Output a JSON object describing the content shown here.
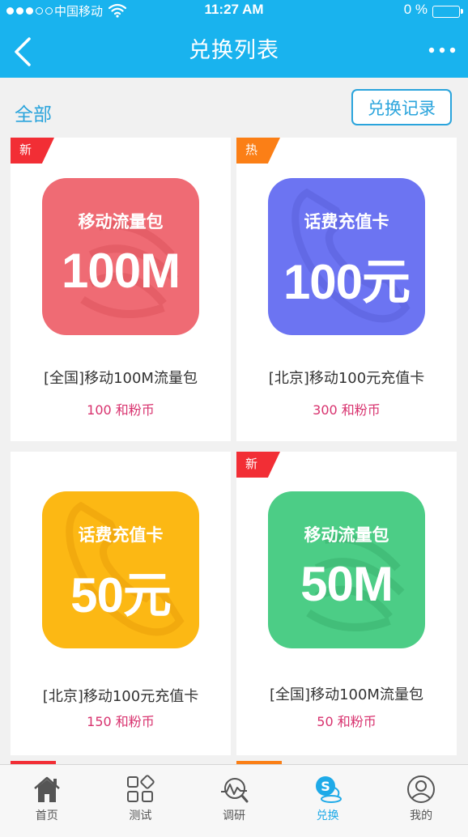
{
  "status_bar": {
    "carrier": "中国移动",
    "time": "11:27 AM",
    "battery": "0 %"
  },
  "nav": {
    "title": "兑换列表"
  },
  "filter": {
    "all_label": "全部",
    "history_label": "兑换记录"
  },
  "items": [
    {
      "badge": "新",
      "badge_color": "#f22e35",
      "tile_color": "#ef6b74",
      "tile_subtitle": "移动流量包",
      "tile_value": "100M",
      "watermark": "china-mobile-logo",
      "name": "[全国]移动100M流量包",
      "price": "100 和粉币"
    },
    {
      "badge": "热",
      "badge_color": "#fb7f16",
      "tile_color": "#6c74f2",
      "tile_subtitle": "话费充值卡",
      "tile_value": "100元",
      "watermark": "phone-handset",
      "name": "[北京]移动100元充值卡",
      "price": "300 和粉币"
    },
    {
      "badge": "",
      "badge_color": "",
      "tile_color": "#fcb814",
      "tile_subtitle": "话费充值卡",
      "tile_value": "50元",
      "watermark": "phone-handset",
      "name": "[北京]移动100元充值卡",
      "price": "150 和粉币"
    },
    {
      "badge": "新",
      "badge_color": "#f22e35",
      "tile_color": "#4ccd86",
      "tile_subtitle": "移动流量包",
      "tile_value": "50M",
      "watermark": "china-mobile-logo",
      "name": "[全国]移动100M流量包",
      "price": "50 和粉币"
    }
  ],
  "tabs": [
    {
      "label": "首页",
      "icon": "home-icon",
      "active": false
    },
    {
      "label": "测试",
      "icon": "grid-icon",
      "active": false
    },
    {
      "label": "调研",
      "icon": "chart-search-icon",
      "active": false
    },
    {
      "label": "兑换",
      "icon": "coin-exchange-icon",
      "active": true
    },
    {
      "label": "我的",
      "icon": "user-icon",
      "active": false
    }
  ],
  "colors": {
    "header": "#19b3ee",
    "accent": "#2aa4dc",
    "price": "#d8326e",
    "background": "#f1f1f1"
  }
}
